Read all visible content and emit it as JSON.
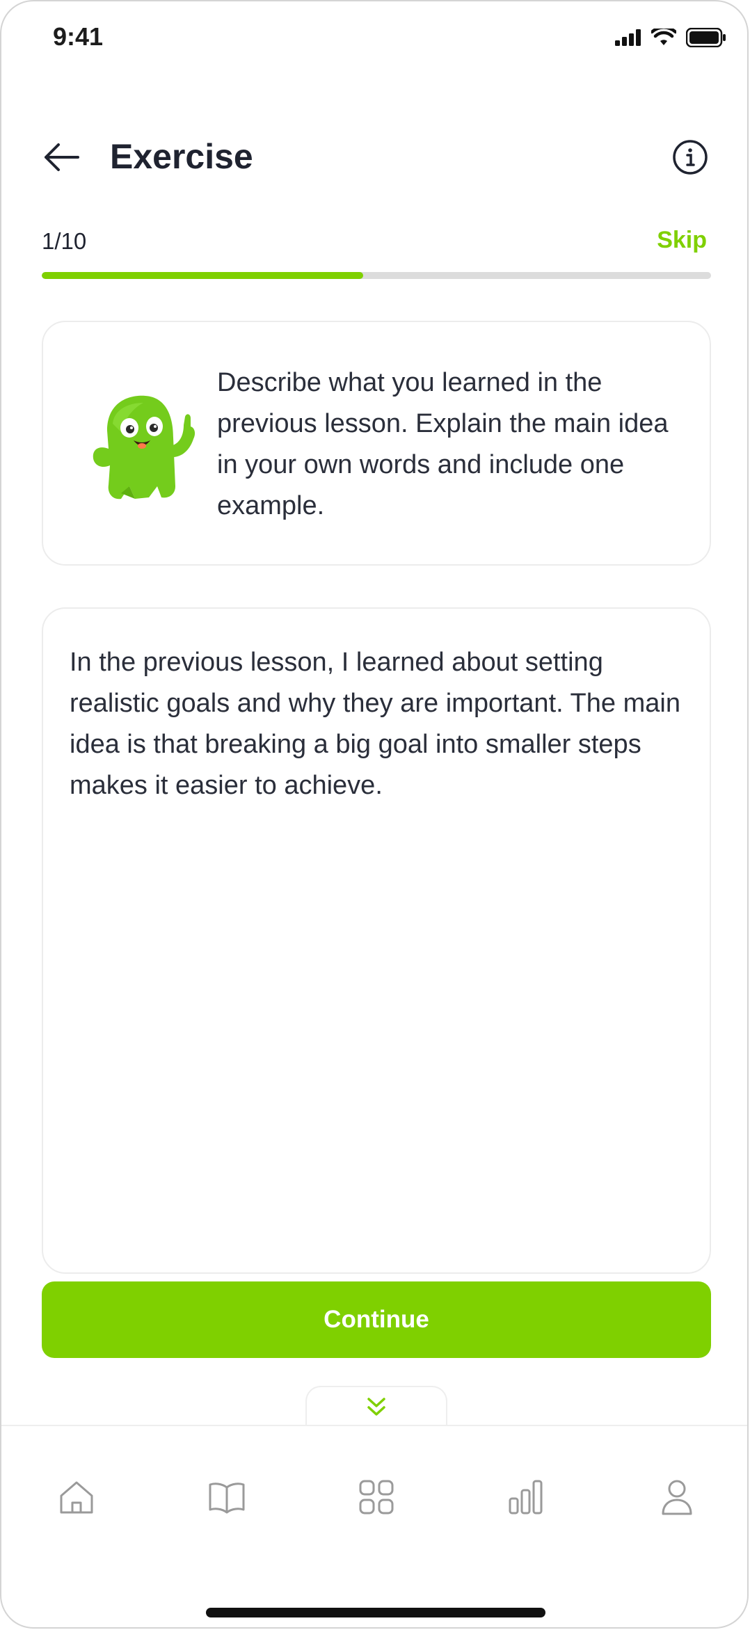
{
  "status_bar": {
    "time": "9:41"
  },
  "header": {
    "title": "Exercise"
  },
  "progress": {
    "label": "1/10",
    "skip_label": "Skip",
    "fraction": 0.48
  },
  "prompt": {
    "text": "Describe what you learned in the previous lesson. Explain the main idea in your own words and include one example."
  },
  "answer": {
    "text": "In the previous lesson, I learned about setting realistic goals and why they are important. The main idea is that breaking a big goal into smaller steps makes it easier to achieve."
  },
  "actions": {
    "continue_label": "Continue"
  },
  "bottom_nav": {
    "items": [
      {
        "icon": "home-icon"
      },
      {
        "icon": "book-icon"
      },
      {
        "icon": "grid-icon"
      },
      {
        "icon": "bar-chart-icon"
      },
      {
        "icon": "profile-icon"
      }
    ]
  },
  "colors": {
    "accent": "#7fd000",
    "track": "#dcdcdc",
    "text": "#1f2330",
    "icon_inactive": "#9a9a9a"
  }
}
